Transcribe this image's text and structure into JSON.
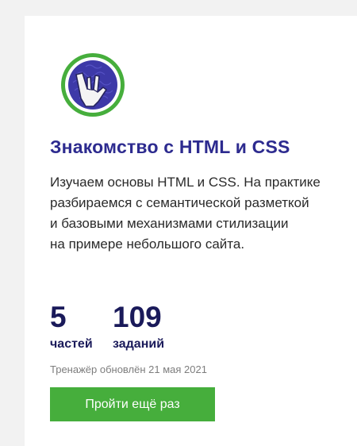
{
  "course": {
    "title": "Знакомство с HTML и CSS",
    "description_lines": [
      "Изучаем основы HTML и CSS. На практике",
      "разбираемся с семантической разметкой",
      "и базовыми механизмами стилизации",
      "на примере небольшого сайта."
    ],
    "badge_icon": "vulcan-salute-hand-icon",
    "stats": [
      {
        "value": "5",
        "label": "частей"
      },
      {
        "value": "109",
        "label": "заданий"
      }
    ],
    "updated_text": "Тренажёр обновлён 21 мая 2021",
    "cta_label": "Пройти ещё раз"
  },
  "colors": {
    "title": "#2d2b8f",
    "stats": "#1a1a5a",
    "badge_ring": "#46ae3c",
    "badge_fill": "#3d39a8",
    "cta_background": "#46ae3c"
  }
}
